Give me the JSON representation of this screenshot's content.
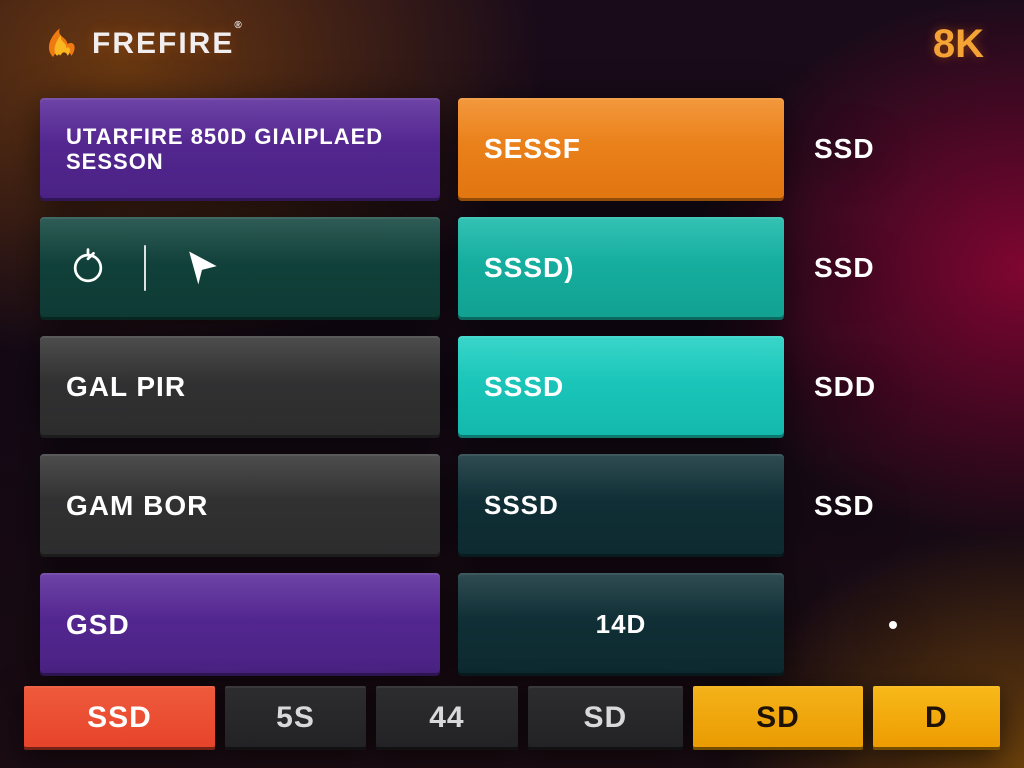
{
  "header": {
    "brand_text": "FREFIRE",
    "brand_reg": "®",
    "right_badge": "8K"
  },
  "rows": [
    {
      "left": "UTARFIRE 850D GIAIPLAED SESSON",
      "mid": "SESSF",
      "right": "SSD"
    },
    {
      "left": "",
      "mid": "SSSD)",
      "right": "SSD"
    },
    {
      "left": "GAL PIR",
      "mid": "SSSD",
      "right": "SDD"
    },
    {
      "left": "GAM BOR",
      "mid": "SSSD",
      "right": "SSD"
    },
    {
      "left": "GSD",
      "mid": "14D",
      "right": "·"
    }
  ],
  "bottom": {
    "tabs": [
      "SSD",
      "5S",
      "44",
      "SD",
      "SD",
      "D"
    ]
  },
  "colors": {
    "purple": "#4a2283",
    "orange": "#e17510",
    "teal_dark": "#0e3a34",
    "teal": "#12a091",
    "cyan": "#14b8ac",
    "slate": "#2c2c2d",
    "navy": "#0d2a30",
    "red": "#e6432a",
    "amber": "#e99a00"
  }
}
